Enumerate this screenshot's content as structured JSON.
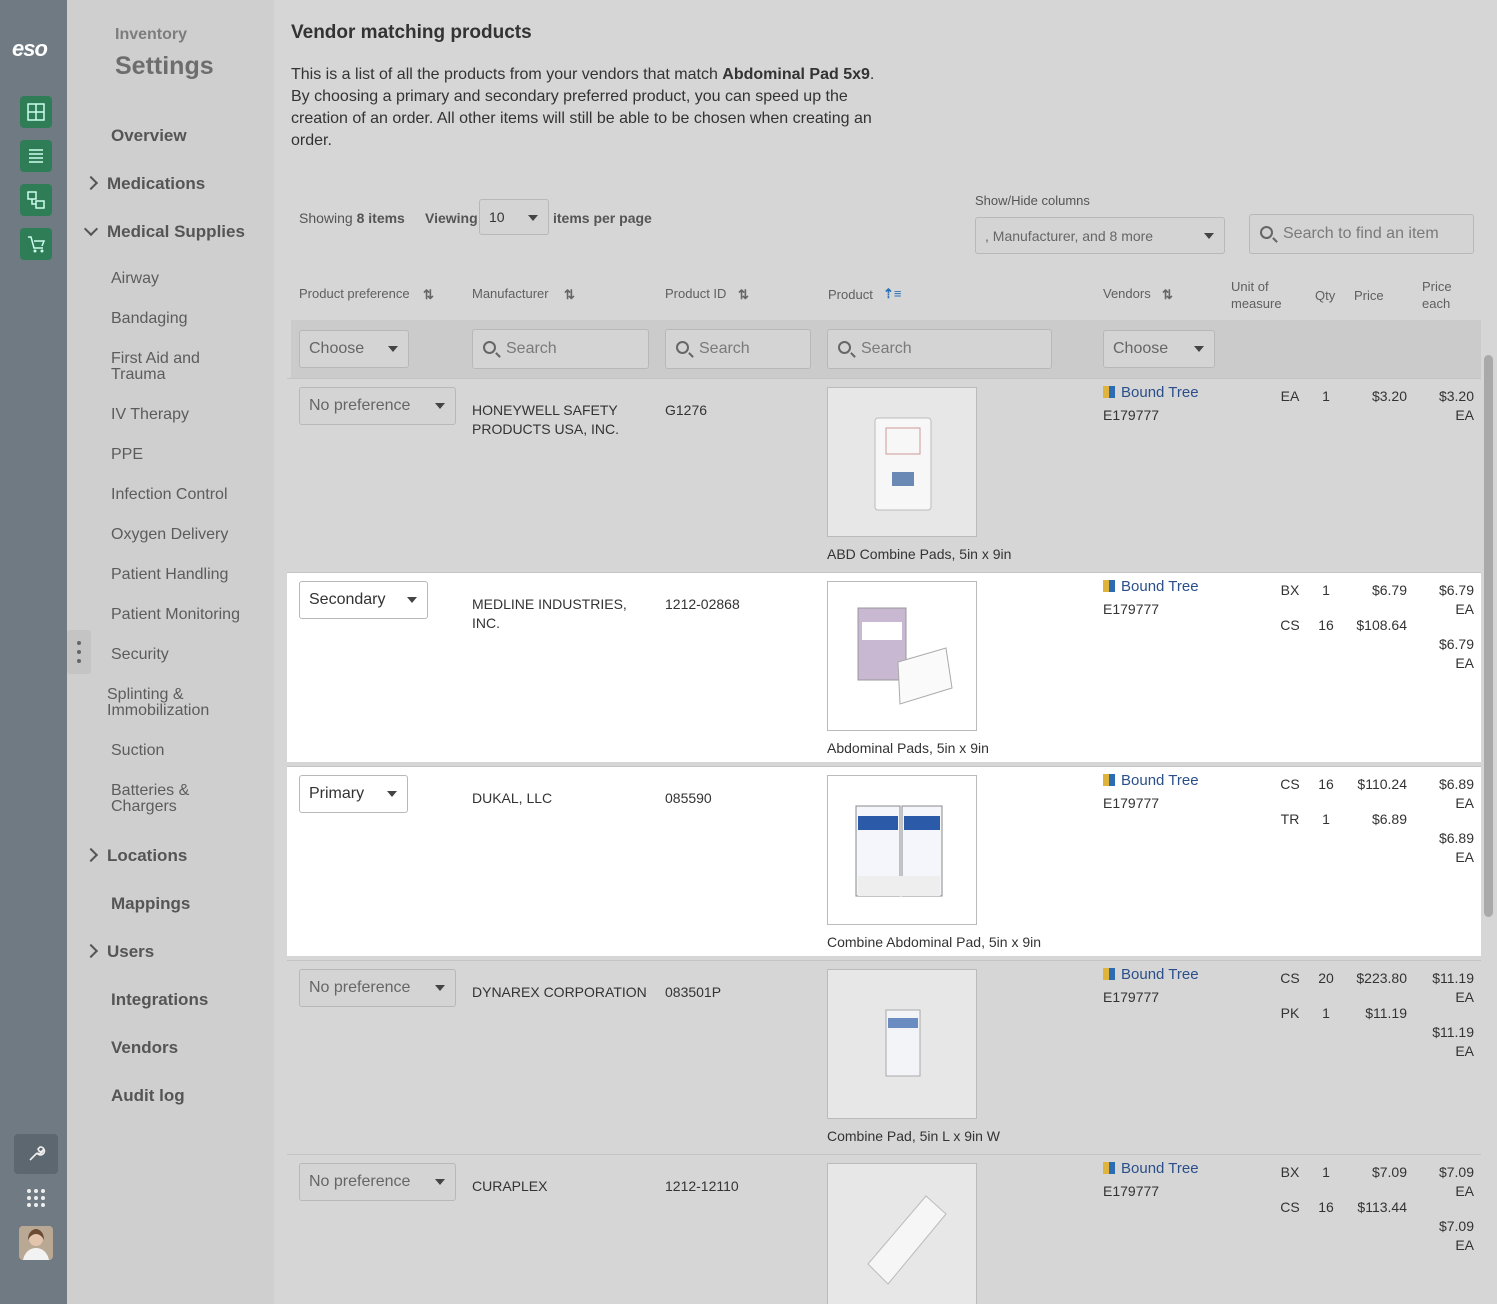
{
  "brand": "eso",
  "sidebar": {
    "kicker": "Inventory",
    "title": "Settings",
    "items": [
      {
        "label": "Overview"
      },
      {
        "label": "Medications"
      },
      {
        "label": "Medical Supplies"
      },
      {
        "label": "Airway"
      },
      {
        "label": "Bandaging"
      },
      {
        "label": "First Aid and Trauma"
      },
      {
        "label": "IV Therapy"
      },
      {
        "label": "PPE"
      },
      {
        "label": "Infection Control"
      },
      {
        "label": "Oxygen Delivery"
      },
      {
        "label": "Patient Handling"
      },
      {
        "label": "Patient Monitoring"
      },
      {
        "label": "Security"
      },
      {
        "label": "Splinting & Immobilization"
      },
      {
        "label": "Suction"
      },
      {
        "label": "Batteries & Chargers"
      },
      {
        "label": "Locations"
      },
      {
        "label": "Mappings"
      },
      {
        "label": "Users"
      },
      {
        "label": "Integrations"
      },
      {
        "label": "Vendors"
      },
      {
        "label": "Audit log"
      }
    ]
  },
  "page": {
    "heading": "Vendor matching products",
    "intro_pre": "This is a list of all the products from your vendors that match ",
    "intro_bold": "Abdominal Pad 5x9",
    "intro_post": ". By choosing a primary and secondary preferred product, you can speed up the creation of an order. All other items will still be able to be chosen when creating an order."
  },
  "toolbar": {
    "showing_prefix": "Showing",
    "showing_count": "8 items",
    "viewing_label": "Viewing",
    "per_page": "10",
    "per_page_suffix": "items per page",
    "columns_label": "Show/Hide columns",
    "columns_value": ", Manufacturer, and 8 more",
    "search_placeholder": "Search to find an item"
  },
  "table": {
    "headers": {
      "preference": "Product preference",
      "manufacturer": "Manufacturer",
      "product_id": "Product ID",
      "product": "Product",
      "vendors": "Vendors",
      "unit": "Unit of measure",
      "qty": "Qty",
      "price": "Price",
      "price_each": "Price each"
    },
    "filters": {
      "preference": "Choose",
      "manufacturer": "Search",
      "product_id": "Search",
      "product": "Search",
      "vendors": "Choose"
    },
    "rows": [
      {
        "preference": "No preference",
        "manufacturer": "HONEYWELL SAFETY PRODUCTS USA, INC.",
        "product_id": "G1276",
        "product": "ABD Combine Pads, 5in x 9in",
        "vendor": "Bound Tree",
        "vendor_code": "E179777",
        "lines": [
          {
            "unit": "EA",
            "qty": "1",
            "price": "$3.20"
          }
        ],
        "each": [
          "$3.20",
          "EA"
        ]
      },
      {
        "preference": "Secondary",
        "manufacturer": "MEDLINE INDUSTRIES, INC.",
        "product_id": "1212-02868",
        "product": "Abdominal Pads, 5in x 9in",
        "vendor": "Bound Tree",
        "vendor_code": "E179777",
        "lines": [
          {
            "unit": "BX",
            "qty": "1",
            "price": "$6.79"
          },
          {
            "unit": "CS",
            "qty": "16",
            "price": "$108.64"
          }
        ],
        "each": [
          "$6.79",
          "EA",
          "$6.79",
          "EA"
        ]
      },
      {
        "preference": "Primary",
        "manufacturer": "DUKAL, LLC",
        "product_id": "085590",
        "product": "Combine Abdominal Pad, 5in x 9in",
        "vendor": "Bound Tree",
        "vendor_code": "E179777",
        "lines": [
          {
            "unit": "CS",
            "qty": "16",
            "price": "$110.24"
          },
          {
            "unit": "TR",
            "qty": "1",
            "price": "$6.89"
          }
        ],
        "each": [
          "$6.89",
          "EA",
          "$6.89",
          "EA"
        ]
      },
      {
        "preference": "No preference",
        "manufacturer": "DYNAREX CORPORATION",
        "product_id": "083501P",
        "product": "Combine Pad, 5in L x 9in W",
        "vendor": "Bound Tree",
        "vendor_code": "E179777",
        "lines": [
          {
            "unit": "CS",
            "qty": "20",
            "price": "$223.80"
          },
          {
            "unit": "PK",
            "qty": "1",
            "price": "$11.19"
          }
        ],
        "each": [
          "$11.19",
          "EA",
          "$11.19",
          "EA"
        ]
      },
      {
        "preference": "No preference",
        "manufacturer": "CURAPLEX",
        "product_id": "1212-12110",
        "product": "",
        "vendor": "Bound Tree",
        "vendor_code": "E179777",
        "lines": [
          {
            "unit": "BX",
            "qty": "1",
            "price": "$7.09"
          },
          {
            "unit": "CS",
            "qty": "16",
            "price": "$113.44"
          }
        ],
        "each": [
          "$7.09",
          "EA",
          "$7.09",
          "EA"
        ]
      }
    ]
  },
  "colors": {
    "rail": "#6f7a83",
    "app_green": "#2f7d57",
    "vendor_blue": "#2a4f8a"
  }
}
